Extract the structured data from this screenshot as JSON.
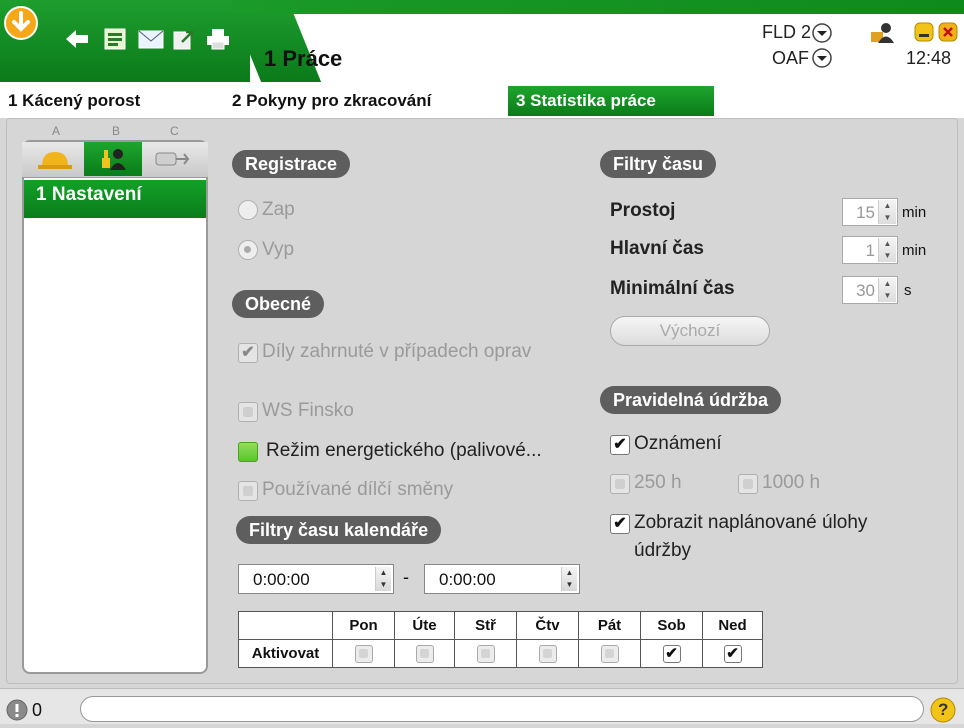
{
  "header": {
    "title": "1 Práce",
    "fld_label": "FLD 2",
    "oaf_label": "OAF",
    "time": "12:48"
  },
  "tabs": [
    {
      "label": "1 Kácený porost"
    },
    {
      "label": "2 Pokyny pro zkracování"
    },
    {
      "label": "3 Statistika práce",
      "active": true
    }
  ],
  "sidebar": {
    "columns": [
      "A",
      "B",
      "C"
    ],
    "items": [
      {
        "label": "1 Nastavení",
        "selected": true
      }
    ]
  },
  "registrace": {
    "heading": "Registrace",
    "options": [
      {
        "label": "Zap",
        "checked": false
      },
      {
        "label": "Vyp",
        "checked": true
      }
    ]
  },
  "obecne": {
    "heading": "Obecné",
    "opt_dily": "Díly zahrnuté v případech oprav",
    "opt_ws": "WS Finsko",
    "opt_rezim": "Režim energetického (palivové...",
    "opt_smeny": "Používané dílčí směny"
  },
  "kalendar": {
    "heading": "Filtry času kalendáře",
    "from": "0:00:00",
    "dash": "-",
    "to": "0:00:00",
    "row_label": "Aktivovat",
    "days": [
      "Pon",
      "Úte",
      "Stř",
      "Čtv",
      "Pát",
      "Sob",
      "Ned"
    ],
    "checked": [
      false,
      false,
      false,
      false,
      false,
      true,
      true
    ]
  },
  "filtry": {
    "heading": "Filtry času",
    "rows": [
      {
        "label": "Prostoj",
        "value": "15",
        "unit": "min"
      },
      {
        "label": "Hlavní čas",
        "value": "1",
        "unit": "min"
      },
      {
        "label": "Minimální čas",
        "value": "30",
        "unit": "s"
      }
    ],
    "default_button": "Výchozí"
  },
  "udrzba": {
    "heading": "Pravidelná údržba",
    "oznameni": "Oznámení",
    "h250": "250 h",
    "h1000": "1000 h",
    "zobrazit_line1": "Zobrazit naplánované úlohy",
    "zobrazit_line2": "údržby"
  },
  "status": {
    "count": "0",
    "help": "?"
  },
  "colors": {
    "accent": "#12a127",
    "pill": "#5e5e5e",
    "orange": "#f0a020"
  }
}
